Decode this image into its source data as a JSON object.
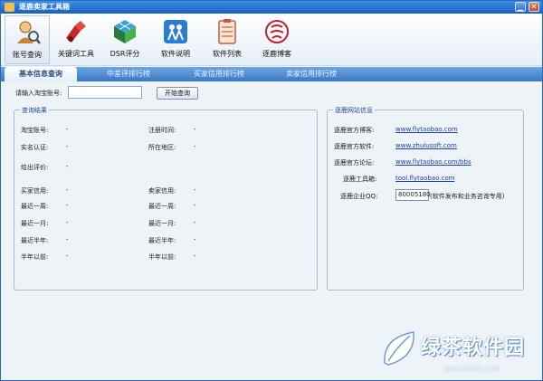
{
  "window": {
    "title": "逐鹿卖家工具箱",
    "min_label": "▁",
    "close_label": "✕"
  },
  "toolbar": [
    {
      "label": "账号查询",
      "icon": "account-query-icon"
    },
    {
      "label": "关键词工具",
      "icon": "keyword-tool-icon"
    },
    {
      "label": "DSR评分",
      "icon": "dsr-rating-icon"
    },
    {
      "label": "软件说明",
      "icon": "software-guide-icon"
    },
    {
      "label": "软件列表",
      "icon": "software-list-icon"
    },
    {
      "label": "逐鹿博客",
      "icon": "zhulu-blog-icon"
    }
  ],
  "tabs": [
    {
      "label": "基本信息查询"
    },
    {
      "label": "中差评排行榜"
    },
    {
      "label": "买家信用排行榜"
    },
    {
      "label": "卖家信用排行榜"
    }
  ],
  "search": {
    "label": "请输入淘宝账号:",
    "value": "",
    "button": "开始查询"
  },
  "results": {
    "legend": "查询结果",
    "taobao_account": {
      "label": "淘宝账号:",
      "value": "-"
    },
    "register_time": {
      "label": "注册时间:",
      "value": "-"
    },
    "realname": {
      "label": "实名认证:",
      "value": "-"
    },
    "region": {
      "label": "所在地区:",
      "value": "-"
    },
    "given_rating": {
      "label": "给出评价:",
      "value": "-"
    },
    "buyer_credit": {
      "label": "买家信用:",
      "value": "-"
    },
    "seller_credit": {
      "label": "卖家信用:",
      "value": "-"
    },
    "b_week": {
      "label": "最近一周:",
      "value": "-"
    },
    "s_week": {
      "label": "最近一周:",
      "value": "-"
    },
    "b_month": {
      "label": "最近一月:",
      "value": "-"
    },
    "s_month": {
      "label": "最近一月:",
      "value": "-"
    },
    "b_half": {
      "label": "最近半年:",
      "value": "-"
    },
    "s_half": {
      "label": "最近半年:",
      "value": "-"
    },
    "b_before": {
      "label": "半年以前:",
      "value": "-"
    },
    "s_before": {
      "label": "半年以前:",
      "value": "-"
    }
  },
  "site": {
    "legend": "逐鹿网站信息",
    "blog": {
      "label": "逐鹿官方博客:",
      "link": "www.flytaobao.com"
    },
    "software": {
      "label": "逐鹿官方软件:",
      "link": "www.zhulusoft.com"
    },
    "forum": {
      "label": "逐鹿官方论坛:",
      "link": "www.flytaobao.com/bbs"
    },
    "mail": {
      "label": "逐鹿工具箱:",
      "link": "tool.flytaobao.com"
    },
    "qq": {
      "label": "逐鹿企业QQ:",
      "value": "80005180",
      "note": "(软件发布和业务咨询专用)"
    }
  },
  "watermark": {
    "name": "绿茶软件园",
    "url": "www.33LC.com"
  },
  "colors": {
    "accent": "#2a68b8",
    "link": "#1a3fb5",
    "legend": "#1f4f9a"
  }
}
